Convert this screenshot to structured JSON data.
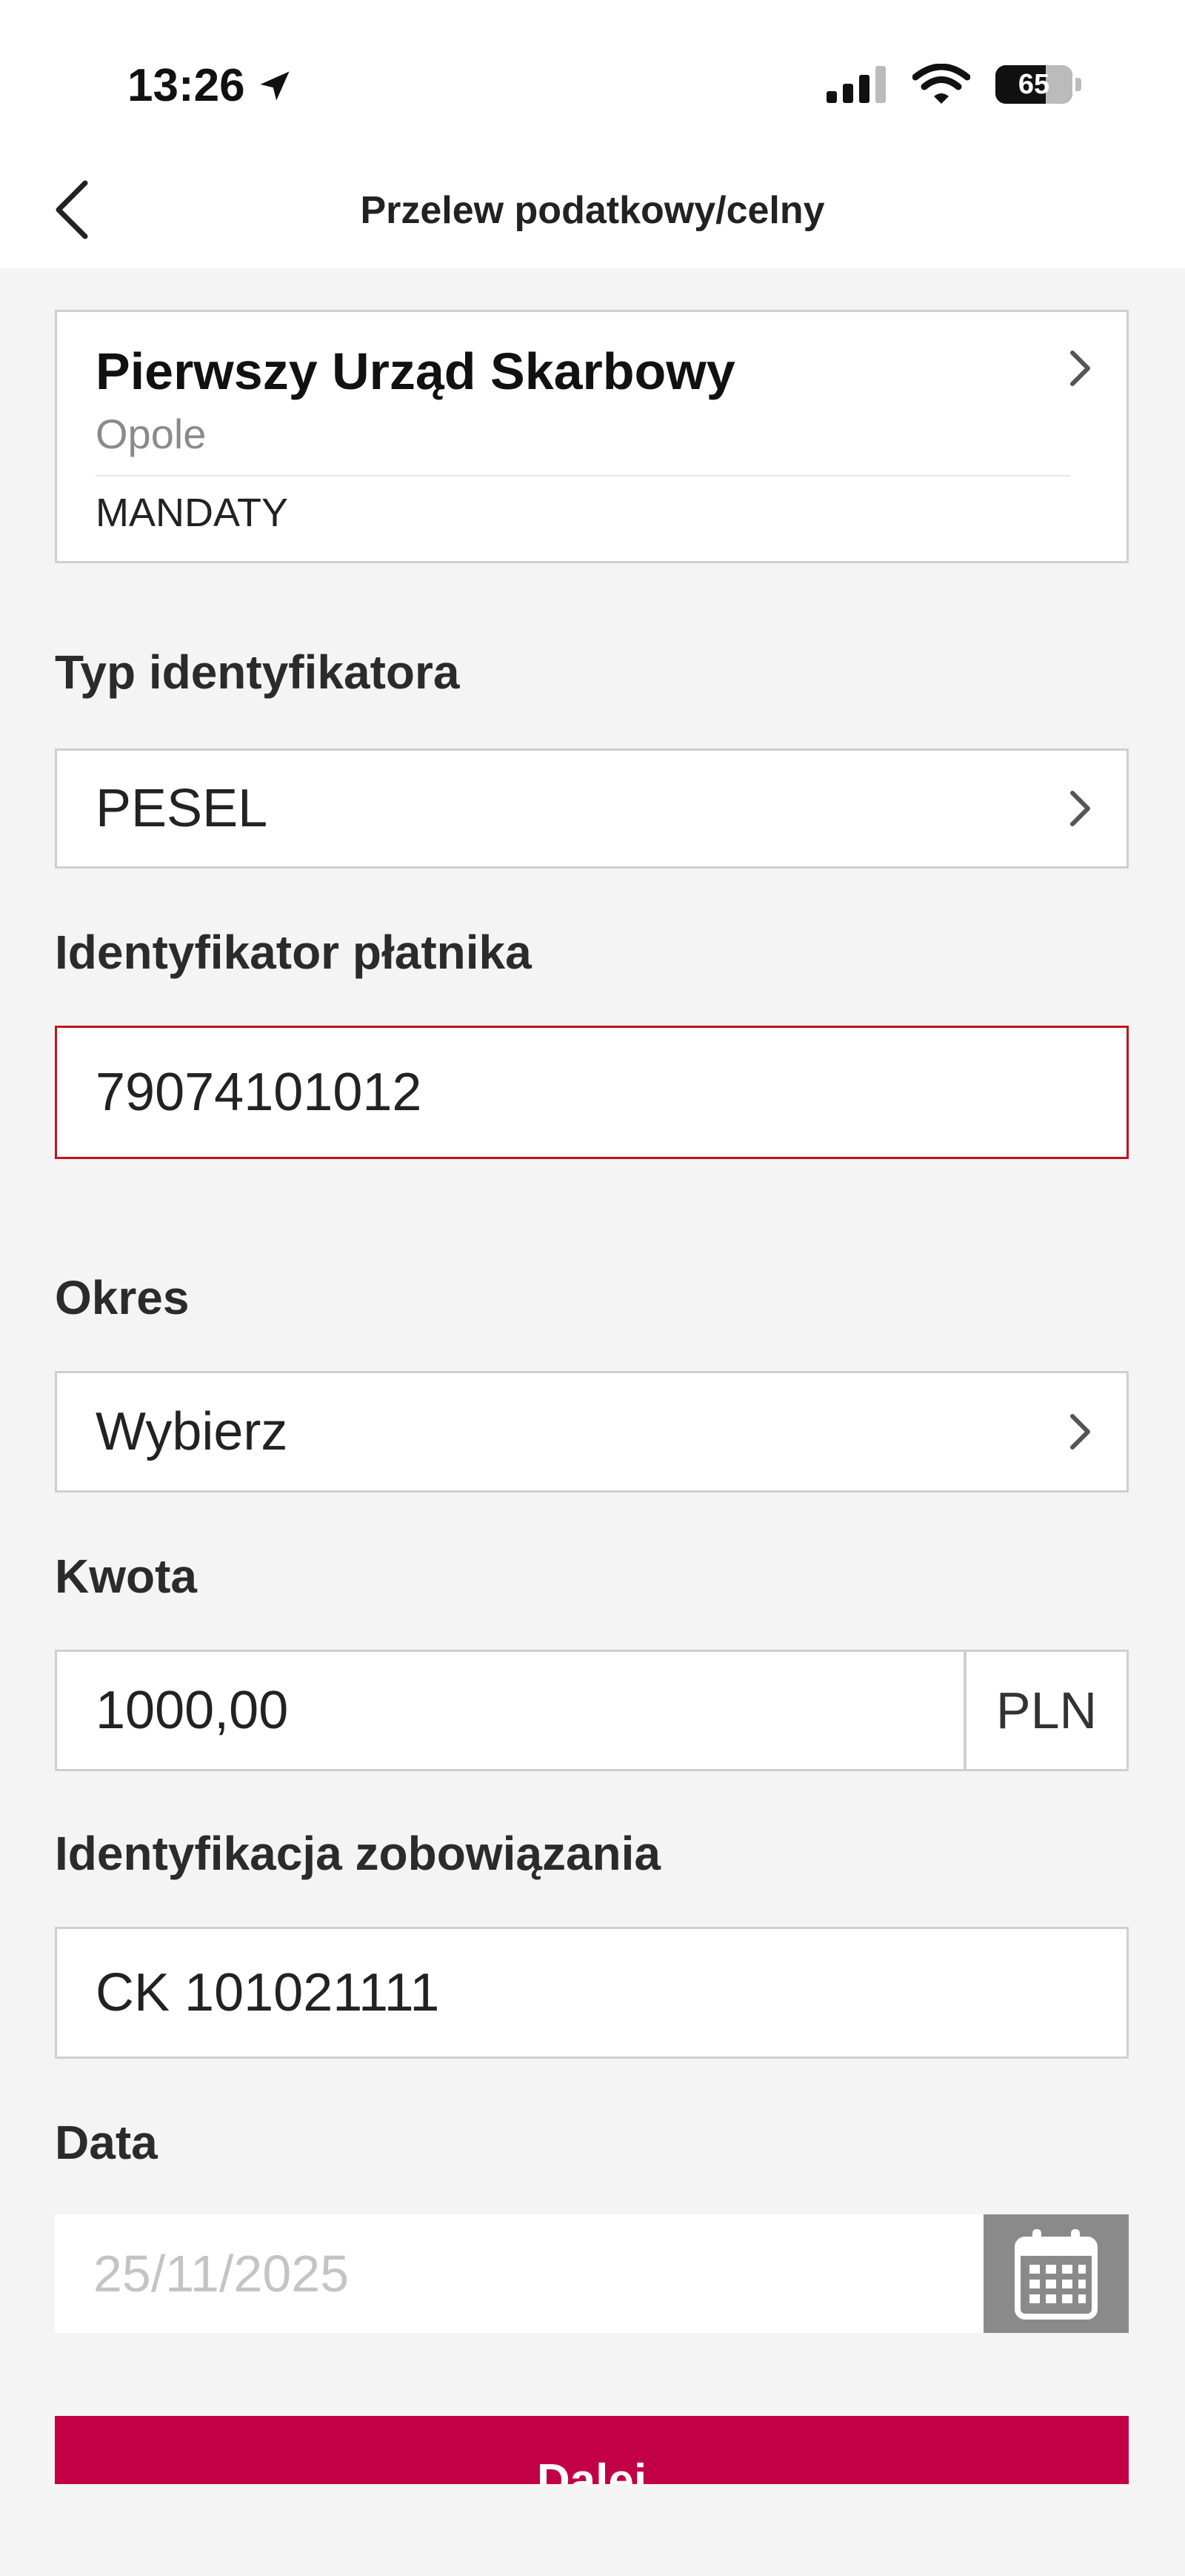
{
  "status_bar": {
    "time": "13:26",
    "battery": "65",
    "icons": [
      "location-arrow-icon",
      "signal-icon",
      "wifi-icon",
      "battery-icon"
    ]
  },
  "nav": {
    "title": "Przelew podatkowy/celny",
    "back_icon": "chevron-left-icon"
  },
  "office": {
    "name": "Pierwszy Urząd Skarbowy",
    "city": "Opole",
    "type": "MANDATY"
  },
  "form": {
    "identifier_type": {
      "label": "Typ identyfikatora",
      "value": "PESEL"
    },
    "payer_id": {
      "label": "Identyfikator płatnika",
      "value": "79074101012"
    },
    "period": {
      "label": "Okres",
      "value": "Wybierz"
    },
    "amount": {
      "label": "Kwota",
      "value": "1000,00",
      "currency": "PLN"
    },
    "obligation": {
      "label": "Identyfikacja zobowiązania",
      "value": "CK 101021111"
    },
    "date": {
      "label": "Data",
      "value": "25/11/2025"
    }
  },
  "actions": {
    "next_label": "Dalej"
  },
  "colors": {
    "accent": "#c10046",
    "error_border": "#c1121f",
    "calendar_button": "#8a8a8a",
    "background": "#f4f4f4"
  }
}
